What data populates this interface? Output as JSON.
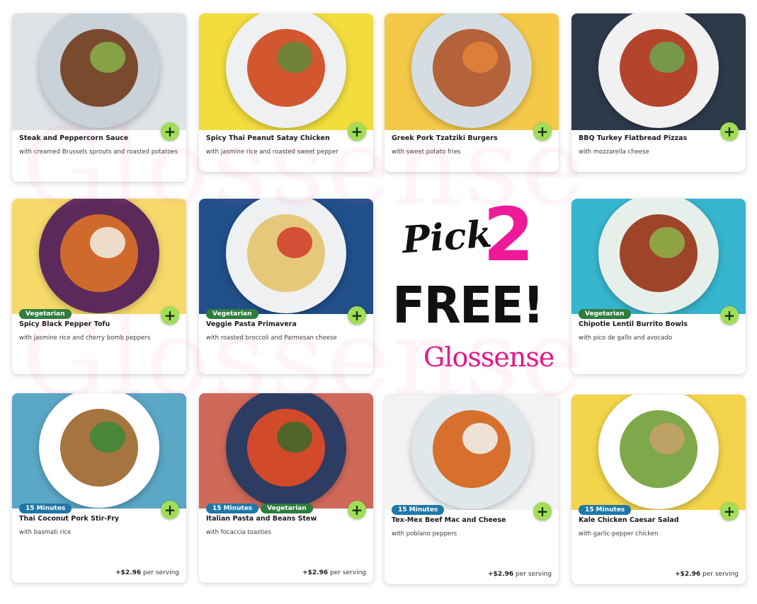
{
  "promo": {
    "pick": "Pick",
    "number": "2",
    "free": "FREE!",
    "brand": "Glossense"
  },
  "watermark": [
    "Glossense",
    "Glossense"
  ],
  "colors": {
    "add_button": "#a2dd57",
    "vegetarian_badge": "#2f7d3d",
    "time_badge": "#1f77a8",
    "promo_pink": "#ee1a98"
  },
  "cards": [
    {
      "title": "Steak and Peppercorn Sauce",
      "subtitle": "with creamed Brussels sprouts and roasted potatoes",
      "badges": [],
      "price": null
    },
    {
      "title": "Spicy Thai Peanut Satay Chicken",
      "subtitle": "with jasmine rice and roasted sweet pepper",
      "badges": [],
      "price": null
    },
    {
      "title": "Greek Pork Tzatziki Burgers",
      "subtitle": "with sweet potato fries",
      "badges": [],
      "price": null
    },
    {
      "title": "BBQ Turkey Flatbread Pizzas",
      "subtitle": "with mozzarella cheese",
      "badges": [],
      "price": null
    },
    {
      "title": "Spicy Black Pepper Tofu",
      "subtitle": "with jasmine rice and cherry bomb peppers",
      "badges": [
        "Vegetarian"
      ],
      "price": null
    },
    {
      "title": "Veggie Pasta Primavera",
      "subtitle": "with roasted broccoli and Parmesan cheese",
      "badges": [
        "Vegetarian"
      ],
      "price": null
    },
    {
      "title": "Chipotle Lentil Burrito Bowls",
      "subtitle": "with pico de gallo and avocado",
      "badges": [
        "Vegetarian"
      ],
      "price": null
    },
    {
      "title": "Thai Coconut Pork Stir-Fry",
      "subtitle": "with basmati rice",
      "badges": [
        "15 Minutes"
      ],
      "price": {
        "amount": "+$2.96",
        "unit": "per serving"
      }
    },
    {
      "title": "Italian Pasta and Beans Stew",
      "subtitle": "with focaccia toasties",
      "badges": [
        "15 Minutes",
        "Vegetarian"
      ],
      "price": {
        "amount": "+$2.96",
        "unit": "per serving"
      }
    },
    {
      "title": "Tex-Mex Beef Mac and Cheese",
      "subtitle": "with poblano peppers",
      "badges": [
        "15 Minutes"
      ],
      "price": {
        "amount": "+$2.96",
        "unit": "per serving"
      }
    },
    {
      "title": "Kale Chicken Caesar Salad",
      "subtitle": "with garlic-pepper chicken",
      "badges": [
        "15 Minutes"
      ],
      "price": {
        "amount": "+$2.96",
        "unit": "per serving"
      }
    }
  ],
  "add_icon": "plus-icon",
  "add_symbol": "+"
}
